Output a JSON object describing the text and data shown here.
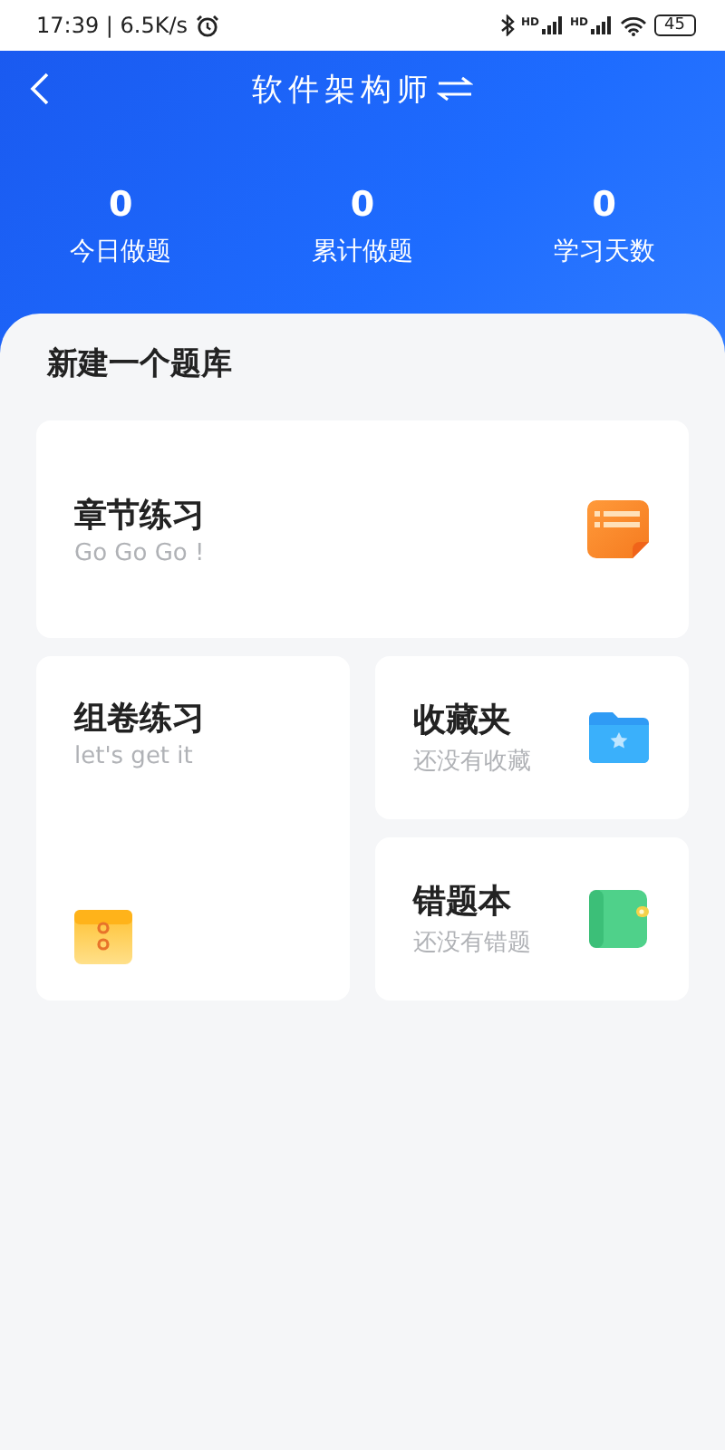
{
  "status_bar": {
    "time": "17:39 | 6.5K/s",
    "signal_labels": [
      "HD",
      "HD"
    ],
    "battery": "45"
  },
  "header": {
    "title": "软件架构师"
  },
  "stats": [
    {
      "value": "0",
      "label": "今日做题"
    },
    {
      "value": "0",
      "label": "累计做题"
    },
    {
      "value": "0",
      "label": "学习天数"
    }
  ],
  "section_title": "新建一个题库",
  "cards": [
    {
      "title": "章节练习",
      "subtitle": "Go Go Go !"
    },
    {
      "title": "组卷练习",
      "subtitle": "let's get it"
    },
    {
      "title": "收藏夹",
      "subtitle": "还没有收藏"
    },
    {
      "title": "错题本",
      "subtitle": "还没有错题"
    }
  ]
}
